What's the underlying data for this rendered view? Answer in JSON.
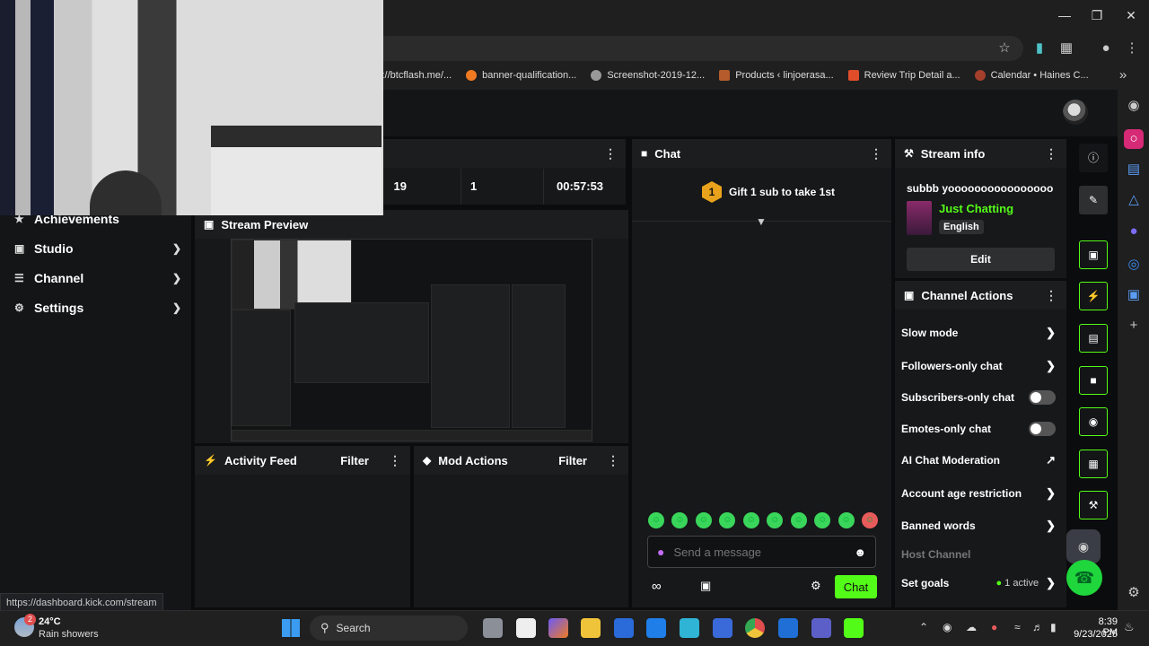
{
  "browser": {
    "bookmarks": [
      {
        "label": "s://btcflash.me/...",
        "color": "#5b8def"
      },
      {
        "label": "banner-qualification...",
        "color": "#f07a22"
      },
      {
        "label": "Screenshot-2019-12...",
        "color": "#cccccc"
      },
      {
        "label": "Products ‹ linjoerasa...",
        "color": "#b55b2c"
      },
      {
        "label": "Review Trip Detail a...",
        "color": "#e04d2a"
      },
      {
        "label": "Calendar • Haines C...",
        "color": "#a33f2b"
      }
    ]
  },
  "sidebar": {
    "items": [
      {
        "label": "Achievements",
        "icon": "trophy-icon"
      },
      {
        "label": "Studio",
        "icon": "studio-icon"
      },
      {
        "label": "Channel",
        "icon": "channel-icon"
      },
      {
        "label": "Settings",
        "icon": "gear-icon"
      }
    ]
  },
  "stats": {
    "viewers": "19",
    "followers": "1",
    "uptime": "00:57:53"
  },
  "stream_preview": {
    "title": "Stream Preview"
  },
  "activity_feed": {
    "title": "Activity Feed",
    "filter": "Filter"
  },
  "mod_actions": {
    "title": "Mod Actions",
    "filter": "Filter"
  },
  "chat": {
    "title": "Chat",
    "gift_badge": "1",
    "gift_text": "Gift 1 sub to take 1st",
    "input_placeholder": "Send a message",
    "send_label": "Chat"
  },
  "stream_info": {
    "title": "Stream info",
    "stream_title": "subbb yoooooooooooooooo",
    "category": "Just Chatting",
    "language": "English",
    "edit_label": "Edit",
    "category_color": "#53fc18"
  },
  "channel_actions": {
    "title": "Channel Actions",
    "rows": [
      {
        "label": "Slow mode",
        "control": "chevron"
      },
      {
        "label": "Followers-only chat",
        "control": "chevron"
      },
      {
        "label": "Subscribers-only chat",
        "control": "toggle"
      },
      {
        "label": "Emotes-only chat",
        "control": "toggle"
      },
      {
        "label": "AI Chat Moderation",
        "control": "external"
      },
      {
        "label": "Account age restriction",
        "control": "chevron"
      },
      {
        "label": "Banned words",
        "control": "chevron"
      },
      {
        "label": "Host Channel",
        "control": "none"
      },
      {
        "label": "Set goals",
        "control": "chevron"
      }
    ],
    "goals_status": "1 active"
  },
  "status_url": "https://dashboard.kick.com/stream",
  "taskbar": {
    "weather_temp": "24°C",
    "weather_desc": "Rain showers",
    "weather_badge": "2",
    "search_label": "Search",
    "time": "8:39 PM",
    "date": "9/23/2025"
  },
  "theme": {
    "accent": "#53fc18"
  }
}
